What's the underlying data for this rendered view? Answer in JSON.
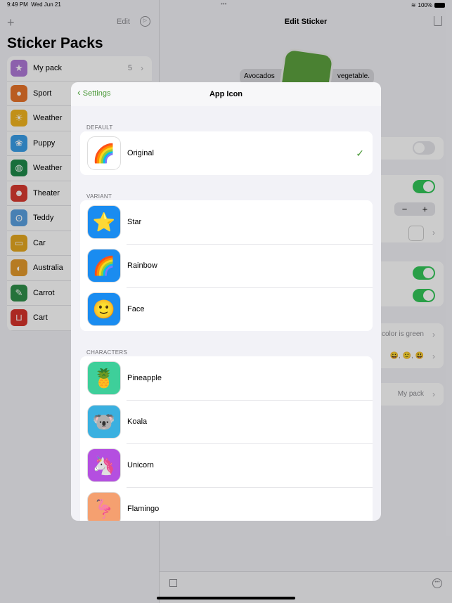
{
  "status": {
    "time": "9:49 PM",
    "date": "Wed Jun 21",
    "battery": "100%"
  },
  "sidebar": {
    "edit": "Edit",
    "title": "Sticker Packs",
    "items": [
      {
        "label": "My pack",
        "count": "5",
        "color": "#af7ad8",
        "icon": "star-icon",
        "glyph": "★"
      },
      {
        "label": "Sport",
        "color": "#e8742a",
        "icon": "basketball-icon",
        "glyph": "●"
      },
      {
        "label": "Weather",
        "color": "#f2b51f",
        "icon": "sun-icon",
        "glyph": "☀"
      },
      {
        "label": "Puppy",
        "color": "#3a9ee8",
        "icon": "paw-icon",
        "glyph": "❀"
      },
      {
        "label": "Weather",
        "color": "#1e8a4a",
        "icon": "gamepad-icon",
        "glyph": "◍"
      },
      {
        "label": "Theater",
        "color": "#d93a30",
        "icon": "masks-icon",
        "glyph": "☻"
      },
      {
        "label": "Teddy",
        "color": "#5aa0e0",
        "icon": "teddy-icon",
        "glyph": "ʘ"
      },
      {
        "label": "Car",
        "color": "#e5a820",
        "icon": "car-icon",
        "glyph": "▭"
      },
      {
        "label": "Australia",
        "color": "#e49a2c",
        "icon": "globe-icon",
        "glyph": "◐"
      },
      {
        "label": "Carrot",
        "color": "#2f8f4a",
        "icon": "carrot-icon",
        "glyph": "✎"
      },
      {
        "label": "Cart",
        "color": "#d6342b",
        "icon": "cart-icon",
        "glyph": "⊔"
      }
    ]
  },
  "detail": {
    "title": "Edit Sticker",
    "caption_left": "Avocados",
    "caption_right": "vegetable.",
    "color_row": "color is green",
    "emoji_row": "😀, 🙂, 😃",
    "pack_row": "My pack"
  },
  "modal": {
    "back": "Settings",
    "title": "App Icon",
    "sections": [
      {
        "header": "DEFAULT",
        "items": [
          {
            "label": "Original",
            "selected": true,
            "bg": "#ffffff",
            "glyph": "🌈"
          }
        ]
      },
      {
        "header": "VARIANT",
        "items": [
          {
            "label": "Star",
            "bg": "#1a8cf0",
            "glyph": "⭐"
          },
          {
            "label": "Rainbow",
            "bg": "#1a8cf0",
            "glyph": "🌈"
          },
          {
            "label": "Face",
            "bg": "#1a8cf0",
            "glyph": "🙂"
          }
        ]
      },
      {
        "header": "CHARACTERS",
        "items": [
          {
            "label": "Pineapple",
            "bg": "#3ecf9a",
            "glyph": "🍍"
          },
          {
            "label": "Koala",
            "bg": "#3ab0e0",
            "glyph": "🐨"
          },
          {
            "label": "Unicorn",
            "bg": "#b44fe0",
            "glyph": "🦄"
          },
          {
            "label": "Flamingo",
            "bg": "#f5a070",
            "glyph": "🦩"
          }
        ]
      }
    ]
  },
  "colors": {
    "accent": "#4c9a3a",
    "toggle_on": "#34c759"
  }
}
